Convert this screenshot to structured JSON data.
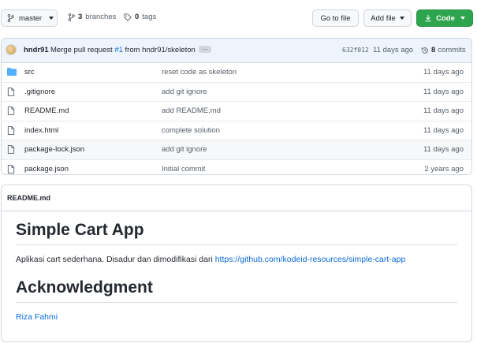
{
  "toolbar": {
    "branch": "master",
    "branches_count": "3",
    "branches_label": "branches",
    "tags_count": "0",
    "tags_label": "tags",
    "go_to_file": "Go to file",
    "add_file": "Add file",
    "code": "Code"
  },
  "commit": {
    "author": "hndr91",
    "message_prefix": "Merge pull request",
    "pr": "#1",
    "message_suffix": "from hndr91/skeleton",
    "ellipsis": "···",
    "sha": "632f012",
    "age": "11 days ago",
    "commits_count": "8",
    "commits_label": "commits"
  },
  "files": [
    {
      "icon": "folder-icon",
      "name": "src",
      "message": "reset code as skeleton",
      "age": "11 days ago"
    },
    {
      "icon": "file-icon",
      "name": ".gitignore",
      "message": "add git ignore",
      "age": "11 days ago"
    },
    {
      "icon": "file-icon",
      "name": "README.md",
      "message": "add README.md",
      "age": "11 days ago"
    },
    {
      "icon": "file-icon",
      "name": "index.html",
      "message": "complete solution",
      "age": "11 days ago"
    },
    {
      "icon": "file-icon",
      "name": "package-lock.json",
      "message": "add git ignore",
      "age": "11 days ago"
    },
    {
      "icon": "file-icon",
      "name": "package.json",
      "message": "Initial commit",
      "age": "2 years ago"
    }
  ],
  "readme": {
    "filename": "README.md",
    "h1": "Simple Cart App",
    "paragraph": "Aplikasi cart sederhana. Disadur dan dimodifikasi dari",
    "paragraph_link": "https://github.com/kodeid-resources/simple-cart-app",
    "h2": "Acknowledgment",
    "ack_link": "Riza Fahmi"
  },
  "colors": {
    "accent": "#0969da",
    "green_button": "#2da44e",
    "folder": "#54aeff"
  }
}
